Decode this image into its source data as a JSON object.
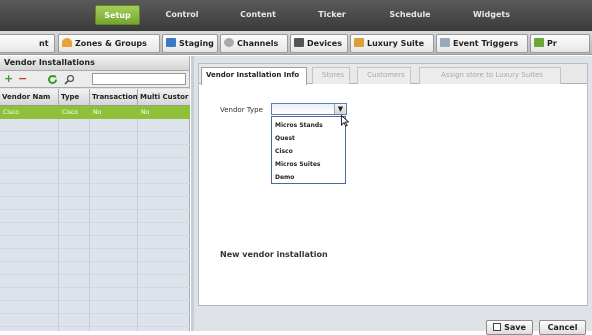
{
  "top_nav": [
    {
      "label": "Setup",
      "active": true
    },
    {
      "label": "Control"
    },
    {
      "label": "Content"
    },
    {
      "label": "Ticker"
    },
    {
      "label": "Schedule"
    },
    {
      "label": "Widgets"
    }
  ],
  "tabs": [
    {
      "label": "nt"
    },
    {
      "label": "Zones & Groups",
      "icon": "zones-groups-icon"
    },
    {
      "label": "Staging",
      "icon": "staging-icon"
    },
    {
      "label": "Channels",
      "icon": "channels-icon"
    },
    {
      "label": "Devices",
      "icon": "devices-icon"
    },
    {
      "label": "Luxury Suite",
      "icon": "luxury-suite-icon"
    },
    {
      "label": "Event Triggers",
      "icon": "event-triggers-icon"
    },
    {
      "label": "Pr",
      "icon": "promotions-icon"
    }
  ],
  "left_panel": {
    "title": "Vendor Installations",
    "toolbar": {
      "add": "+",
      "remove": "−",
      "refresh": "refresh-icon",
      "search": "search-icon"
    },
    "columns": [
      "Vendor Nam",
      "Type",
      "Transaction",
      "Multi Custor"
    ],
    "rows": [
      [
        "Cisco",
        "Cisco",
        "No",
        "No"
      ]
    ]
  },
  "detail_tabs": [
    {
      "label": "Vendor Installation Info",
      "active": true
    },
    {
      "label": "Stores"
    },
    {
      "label": "Customers"
    },
    {
      "label": "Assign store to Luxury Suites"
    }
  ],
  "form": {
    "vendor_type_label": "Vendor Type",
    "vendor_type_value": "",
    "dropdown_options": [
      "Micros Stands",
      "Quest",
      "Cisco",
      "Micros Suites",
      "Demo"
    ],
    "status_text": "New vendor installation"
  },
  "buttons": {
    "save": "Save",
    "cancel": "Cancel"
  },
  "colors": {
    "accent": "#8fc03a",
    "nav_bg": "#4a4a4a",
    "selection": "#8fc03a"
  }
}
